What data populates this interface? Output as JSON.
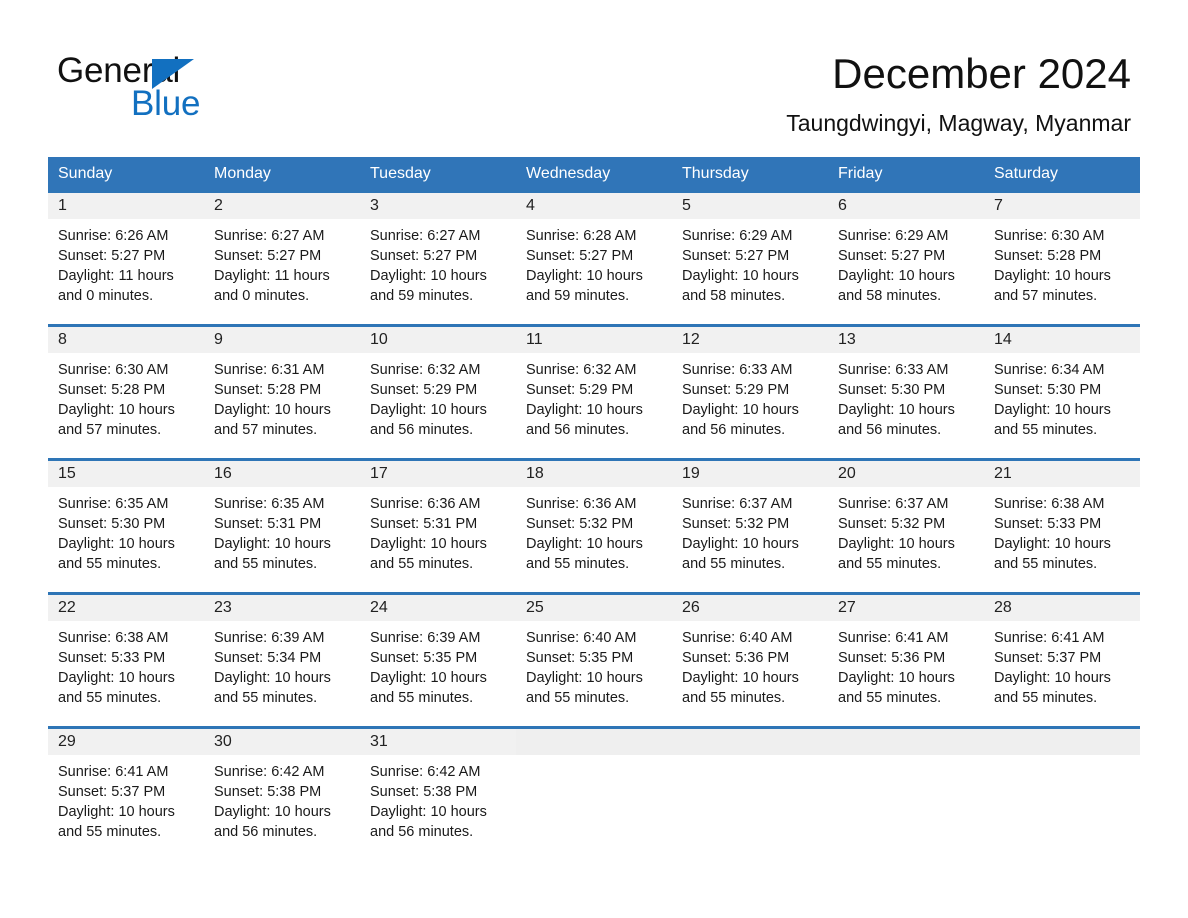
{
  "brand": {
    "name_part1": "General",
    "name_part2": "Blue",
    "flag_icon": "blue-triangle-flag-icon",
    "accent_color": "#1270c0"
  },
  "header": {
    "title": "December 2024",
    "location": "Taungdwingyi, Magway, Myanmar"
  },
  "theme": {
    "header_blue": "#3075b8",
    "row_rule_blue": "#2e75b6",
    "day_band_gray": "#f1f1f1",
    "page_background": "#ffffff"
  },
  "weekdays": [
    "Sunday",
    "Monday",
    "Tuesday",
    "Wednesday",
    "Thursday",
    "Friday",
    "Saturday"
  ],
  "labels": {
    "sunrise_prefix": "Sunrise:",
    "sunset_prefix": "Sunset:",
    "daylight_prefix": "Daylight:"
  },
  "weeks": [
    [
      {
        "day": "1",
        "sunrise": "Sunrise: 6:26 AM",
        "sunset": "Sunset: 5:27 PM",
        "daylight_line1": "Daylight: 11 hours",
        "daylight_line2": "and 0 minutes."
      },
      {
        "day": "2",
        "sunrise": "Sunrise: 6:27 AM",
        "sunset": "Sunset: 5:27 PM",
        "daylight_line1": "Daylight: 11 hours",
        "daylight_line2": "and 0 minutes."
      },
      {
        "day": "3",
        "sunrise": "Sunrise: 6:27 AM",
        "sunset": "Sunset: 5:27 PM",
        "daylight_line1": "Daylight: 10 hours",
        "daylight_line2": "and 59 minutes."
      },
      {
        "day": "4",
        "sunrise": "Sunrise: 6:28 AM",
        "sunset": "Sunset: 5:27 PM",
        "daylight_line1": "Daylight: 10 hours",
        "daylight_line2": "and 59 minutes."
      },
      {
        "day": "5",
        "sunrise": "Sunrise: 6:29 AM",
        "sunset": "Sunset: 5:27 PM",
        "daylight_line1": "Daylight: 10 hours",
        "daylight_line2": "and 58 minutes."
      },
      {
        "day": "6",
        "sunrise": "Sunrise: 6:29 AM",
        "sunset": "Sunset: 5:27 PM",
        "daylight_line1": "Daylight: 10 hours",
        "daylight_line2": "and 58 minutes."
      },
      {
        "day": "7",
        "sunrise": "Sunrise: 6:30 AM",
        "sunset": "Sunset: 5:28 PM",
        "daylight_line1": "Daylight: 10 hours",
        "daylight_line2": "and 57 minutes."
      }
    ],
    [
      {
        "day": "8",
        "sunrise": "Sunrise: 6:30 AM",
        "sunset": "Sunset: 5:28 PM",
        "daylight_line1": "Daylight: 10 hours",
        "daylight_line2": "and 57 minutes."
      },
      {
        "day": "9",
        "sunrise": "Sunrise: 6:31 AM",
        "sunset": "Sunset: 5:28 PM",
        "daylight_line1": "Daylight: 10 hours",
        "daylight_line2": "and 57 minutes."
      },
      {
        "day": "10",
        "sunrise": "Sunrise: 6:32 AM",
        "sunset": "Sunset: 5:29 PM",
        "daylight_line1": "Daylight: 10 hours",
        "daylight_line2": "and 56 minutes."
      },
      {
        "day": "11",
        "sunrise": "Sunrise: 6:32 AM",
        "sunset": "Sunset: 5:29 PM",
        "daylight_line1": "Daylight: 10 hours",
        "daylight_line2": "and 56 minutes."
      },
      {
        "day": "12",
        "sunrise": "Sunrise: 6:33 AM",
        "sunset": "Sunset: 5:29 PM",
        "daylight_line1": "Daylight: 10 hours",
        "daylight_line2": "and 56 minutes."
      },
      {
        "day": "13",
        "sunrise": "Sunrise: 6:33 AM",
        "sunset": "Sunset: 5:30 PM",
        "daylight_line1": "Daylight: 10 hours",
        "daylight_line2": "and 56 minutes."
      },
      {
        "day": "14",
        "sunrise": "Sunrise: 6:34 AM",
        "sunset": "Sunset: 5:30 PM",
        "daylight_line1": "Daylight: 10 hours",
        "daylight_line2": "and 55 minutes."
      }
    ],
    [
      {
        "day": "15",
        "sunrise": "Sunrise: 6:35 AM",
        "sunset": "Sunset: 5:30 PM",
        "daylight_line1": "Daylight: 10 hours",
        "daylight_line2": "and 55 minutes."
      },
      {
        "day": "16",
        "sunrise": "Sunrise: 6:35 AM",
        "sunset": "Sunset: 5:31 PM",
        "daylight_line1": "Daylight: 10 hours",
        "daylight_line2": "and 55 minutes."
      },
      {
        "day": "17",
        "sunrise": "Sunrise: 6:36 AM",
        "sunset": "Sunset: 5:31 PM",
        "daylight_line1": "Daylight: 10 hours",
        "daylight_line2": "and 55 minutes."
      },
      {
        "day": "18",
        "sunrise": "Sunrise: 6:36 AM",
        "sunset": "Sunset: 5:32 PM",
        "daylight_line1": "Daylight: 10 hours",
        "daylight_line2": "and 55 minutes."
      },
      {
        "day": "19",
        "sunrise": "Sunrise: 6:37 AM",
        "sunset": "Sunset: 5:32 PM",
        "daylight_line1": "Daylight: 10 hours",
        "daylight_line2": "and 55 minutes."
      },
      {
        "day": "20",
        "sunrise": "Sunrise: 6:37 AM",
        "sunset": "Sunset: 5:32 PM",
        "daylight_line1": "Daylight: 10 hours",
        "daylight_line2": "and 55 minutes."
      },
      {
        "day": "21",
        "sunrise": "Sunrise: 6:38 AM",
        "sunset": "Sunset: 5:33 PM",
        "daylight_line1": "Daylight: 10 hours",
        "daylight_line2": "and 55 minutes."
      }
    ],
    [
      {
        "day": "22",
        "sunrise": "Sunrise: 6:38 AM",
        "sunset": "Sunset: 5:33 PM",
        "daylight_line1": "Daylight: 10 hours",
        "daylight_line2": "and 55 minutes."
      },
      {
        "day": "23",
        "sunrise": "Sunrise: 6:39 AM",
        "sunset": "Sunset: 5:34 PM",
        "daylight_line1": "Daylight: 10 hours",
        "daylight_line2": "and 55 minutes."
      },
      {
        "day": "24",
        "sunrise": "Sunrise: 6:39 AM",
        "sunset": "Sunset: 5:35 PM",
        "daylight_line1": "Daylight: 10 hours",
        "daylight_line2": "and 55 minutes."
      },
      {
        "day": "25",
        "sunrise": "Sunrise: 6:40 AM",
        "sunset": "Sunset: 5:35 PM",
        "daylight_line1": "Daylight: 10 hours",
        "daylight_line2": "and 55 minutes."
      },
      {
        "day": "26",
        "sunrise": "Sunrise: 6:40 AM",
        "sunset": "Sunset: 5:36 PM",
        "daylight_line1": "Daylight: 10 hours",
        "daylight_line2": "and 55 minutes."
      },
      {
        "day": "27",
        "sunrise": "Sunrise: 6:41 AM",
        "sunset": "Sunset: 5:36 PM",
        "daylight_line1": "Daylight: 10 hours",
        "daylight_line2": "and 55 minutes."
      },
      {
        "day": "28",
        "sunrise": "Sunrise: 6:41 AM",
        "sunset": "Sunset: 5:37 PM",
        "daylight_line1": "Daylight: 10 hours",
        "daylight_line2": "and 55 minutes."
      }
    ],
    [
      {
        "day": "29",
        "sunrise": "Sunrise: 6:41 AM",
        "sunset": "Sunset: 5:37 PM",
        "daylight_line1": "Daylight: 10 hours",
        "daylight_line2": "and 55 minutes."
      },
      {
        "day": "30",
        "sunrise": "Sunrise: 6:42 AM",
        "sunset": "Sunset: 5:38 PM",
        "daylight_line1": "Daylight: 10 hours",
        "daylight_line2": "and 56 minutes."
      },
      {
        "day": "31",
        "sunrise": "Sunrise: 6:42 AM",
        "sunset": "Sunset: 5:38 PM",
        "daylight_line1": "Daylight: 10 hours",
        "daylight_line2": "and 56 minutes."
      },
      {
        "day": "",
        "sunrise": "",
        "sunset": "",
        "daylight_line1": "",
        "daylight_line2": ""
      },
      {
        "day": "",
        "sunrise": "",
        "sunset": "",
        "daylight_line1": "",
        "daylight_line2": ""
      },
      {
        "day": "",
        "sunrise": "",
        "sunset": "",
        "daylight_line1": "",
        "daylight_line2": ""
      },
      {
        "day": "",
        "sunrise": "",
        "sunset": "",
        "daylight_line1": "",
        "daylight_line2": ""
      }
    ]
  ]
}
